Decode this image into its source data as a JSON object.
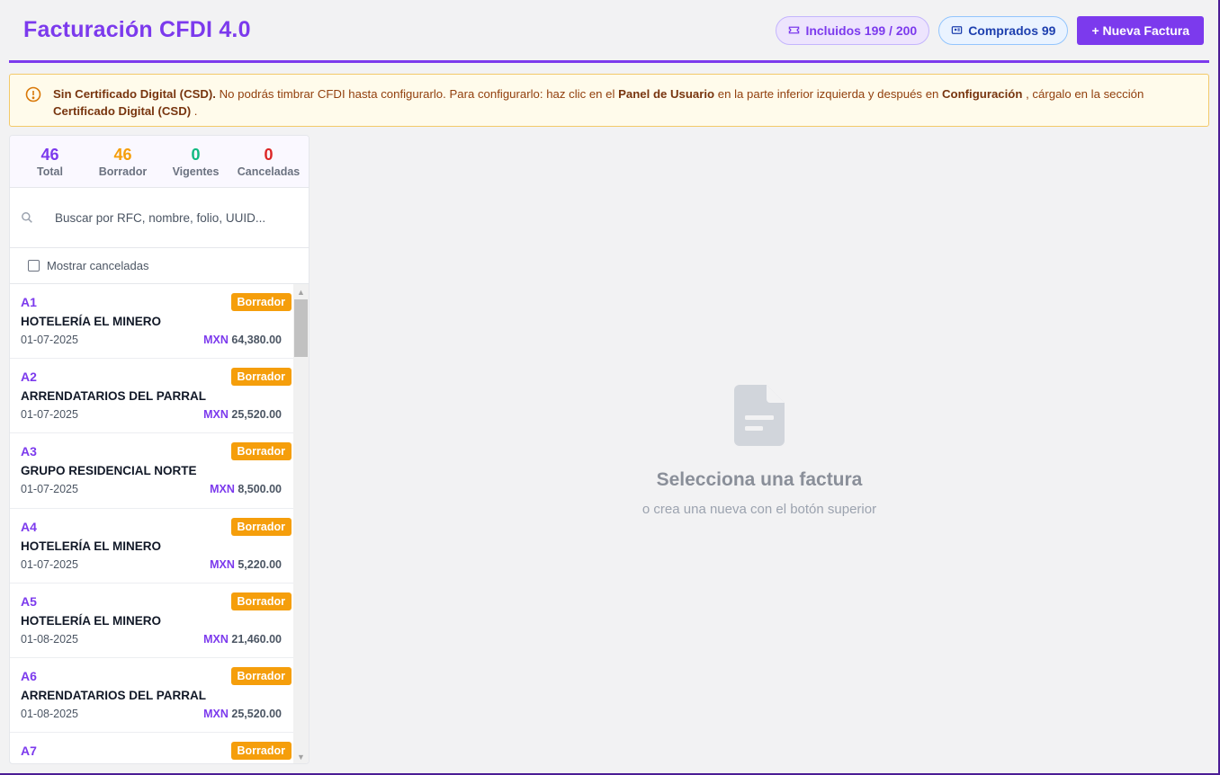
{
  "header": {
    "title": "Facturación CFDI 4.0",
    "included_label": "Incluidos 199 / 200",
    "bought_label": "Comprados 99",
    "new_button": "+ Nueva Factura"
  },
  "warning": {
    "icon": "alert-circle-icon",
    "strong1": "Sin Certificado Digital (CSD).",
    "text1": " No podrás timbrar CFDI hasta configurarlo. Para configurarlo: haz clic en el ",
    "strong2": "Panel de Usuario",
    "text2": " en la parte inferior izquierda y después en ",
    "strong3": "Configuración",
    "text3": " , cárgalo en la sección ",
    "strong4": "Certificado Digital (CSD)",
    "text4": " ."
  },
  "stats": [
    {
      "value": "46",
      "label": "Total"
    },
    {
      "value": "46",
      "label": "Borrador"
    },
    {
      "value": "0",
      "label": "Vigentes"
    },
    {
      "value": "0",
      "label": "Canceladas"
    }
  ],
  "search": {
    "placeholder": "Buscar por RFC, nombre, folio, UUID..."
  },
  "filter": {
    "label": "Mostrar canceladas",
    "checked": false
  },
  "invoices": [
    {
      "folio": "A1",
      "status": "Borrador",
      "client": "HOTELERÍA EL MINERO",
      "date": "01-07-2025",
      "currency": "MXN",
      "amount": "64,380.00"
    },
    {
      "folio": "A2",
      "status": "Borrador",
      "client": "ARRENDATARIOS DEL PARRAL",
      "date": "01-07-2025",
      "currency": "MXN",
      "amount": "25,520.00"
    },
    {
      "folio": "A3",
      "status": "Borrador",
      "client": "GRUPO RESIDENCIAL NORTE",
      "date": "01-07-2025",
      "currency": "MXN",
      "amount": "8,500.00"
    },
    {
      "folio": "A4",
      "status": "Borrador",
      "client": "HOTELERÍA EL MINERO",
      "date": "01-07-2025",
      "currency": "MXN",
      "amount": "5,220.00"
    },
    {
      "folio": "A5",
      "status": "Borrador",
      "client": "HOTELERÍA EL MINERO",
      "date": "01-08-2025",
      "currency": "MXN",
      "amount": "21,460.00"
    },
    {
      "folio": "A6",
      "status": "Borrador",
      "client": "ARRENDATARIOS DEL PARRAL",
      "date": "01-08-2025",
      "currency": "MXN",
      "amount": "25,520.00"
    },
    {
      "folio": "A7",
      "status": "Borrador",
      "client": "",
      "date": "",
      "currency": "",
      "amount": ""
    }
  ],
  "empty_state": {
    "icon": "document-icon",
    "title": "Selecciona una factura",
    "subtitle": "o crea una nueva con el botón superior"
  },
  "colors": {
    "accent": "#7c3aed",
    "draft": "#f59e0b",
    "valid": "#10b981",
    "cancelled": "#dc2626"
  }
}
